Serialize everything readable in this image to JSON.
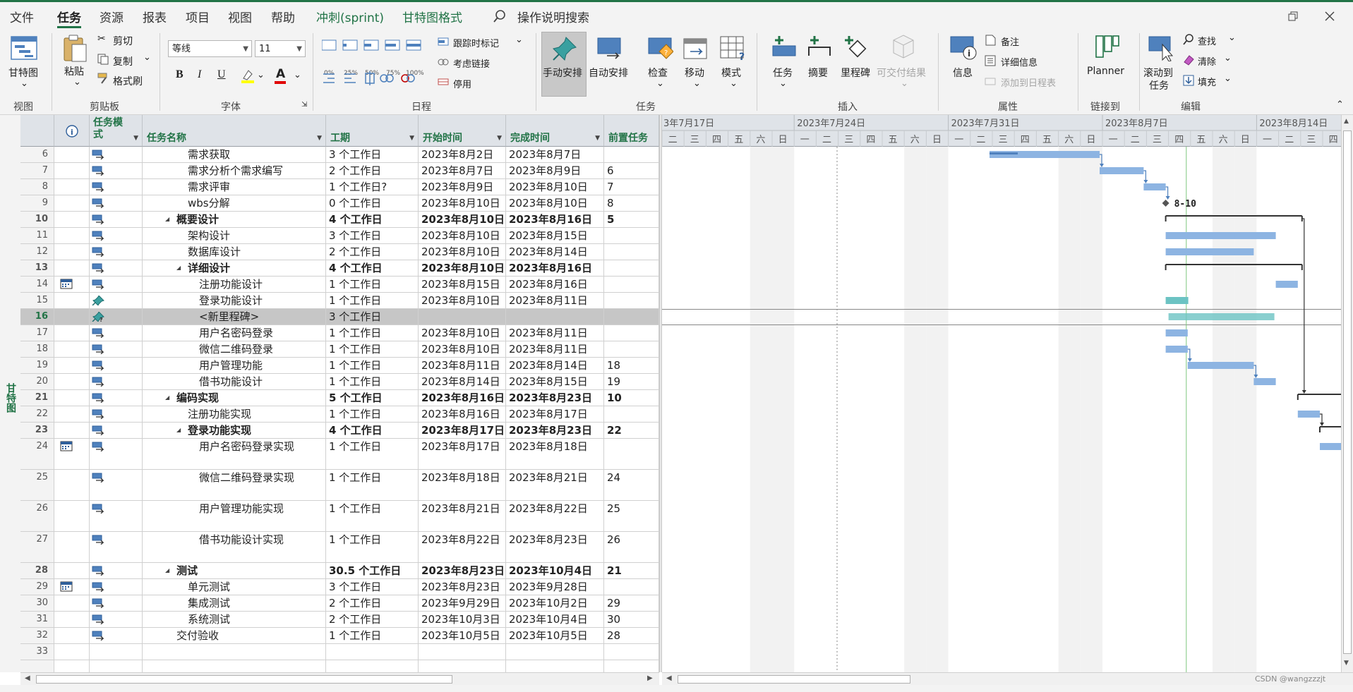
{
  "menu": {
    "items": [
      "文件",
      "任务",
      "资源",
      "报表",
      "项目",
      "视图",
      "帮助",
      "冲刺(sprint)",
      "甘特图格式"
    ],
    "search": "操作说明搜索"
  },
  "ribbon": {
    "gantt_view": "甘特图",
    "paste": "粘贴",
    "cut": "剪切",
    "copy": "复制",
    "format_painter": "格式刷",
    "font_name": "等线",
    "font_size": "11",
    "bold": "B",
    "italic": "I",
    "underline": "U",
    "pct": [
      "0%",
      "25%",
      "50%",
      "75%",
      "100%"
    ],
    "mark_on_track": "跟踪时标记",
    "respect_links": "考虑链接",
    "inactivate": "停用",
    "manual_schedule": "手动安排",
    "auto_schedule": "自动安排",
    "inspect": "检查",
    "move": "移动",
    "mode": "模式",
    "task": "任务",
    "summary": "摘要",
    "milestone": "里程碑",
    "deliverable": "可交付结果",
    "information": "信息",
    "notes": "备注",
    "details": "详细信息",
    "add_to_timeline": "添加到日程表",
    "planner": "Planner",
    "scroll_to_task_1": "滚动到",
    "scroll_to_task_2": "任务",
    "find": "查找",
    "clear": "清除",
    "fill": "填充",
    "groups": [
      "视图",
      "剪贴板",
      "字体",
      "日程",
      "任务",
      "插入",
      "属性",
      "链接到",
      "编辑"
    ]
  },
  "sidebar_label": "甘特图",
  "table": {
    "headers": [
      "任务模式",
      "任务名称",
      "工期",
      "开始时间",
      "完成时间",
      "前置任务"
    ],
    "rows": [
      {
        "id": "6",
        "name": "需求获取",
        "duration": "3 个工作日",
        "start": "2023年8月2日",
        "finish": "2023年8月7日",
        "pred": "",
        "indent": 2,
        "bold": false,
        "summary": false,
        "mode": "auto"
      },
      {
        "id": "7",
        "name": "需求分析个需求编写",
        "duration": "2 个工作日",
        "start": "2023年8月7日",
        "finish": "2023年8月9日",
        "pred": "6",
        "indent": 2,
        "bold": false,
        "summary": false,
        "mode": "auto"
      },
      {
        "id": "8",
        "name": "需求评审",
        "duration": "1 个工作日?",
        "start": "2023年8月9日",
        "finish": "2023年8月10日",
        "pred": "7",
        "indent": 2,
        "bold": false,
        "summary": false,
        "mode": "auto"
      },
      {
        "id": "9",
        "name": "wbs分解",
        "duration": "0 个工作日",
        "start": "2023年8月10日",
        "finish": "2023年8月10日",
        "pred": "8",
        "indent": 2,
        "bold": false,
        "summary": false,
        "mode": "auto"
      },
      {
        "id": "10",
        "name": "概要设计",
        "duration": "4 个工作日",
        "start": "2023年8月10日",
        "finish": "2023年8月16日",
        "pred": "5",
        "indent": 1,
        "bold": true,
        "summary": true,
        "mode": "auto"
      },
      {
        "id": "11",
        "name": "架构设计",
        "duration": "3 个工作日",
        "start": "2023年8月10日",
        "finish": "2023年8月15日",
        "pred": "",
        "indent": 2,
        "bold": false,
        "summary": false,
        "mode": "auto"
      },
      {
        "id": "12",
        "name": "数据库设计",
        "duration": "2 个工作日",
        "start": "2023年8月10日",
        "finish": "2023年8月14日",
        "pred": "",
        "indent": 2,
        "bold": false,
        "summary": false,
        "mode": "auto"
      },
      {
        "id": "13",
        "name": "详细设计",
        "duration": "4 个工作日",
        "start": "2023年8月10日",
        "finish": "2023年8月16日",
        "pred": "",
        "indent": 2,
        "bold": true,
        "summary": true,
        "mode": "auto"
      },
      {
        "id": "14",
        "name": "注册功能设计",
        "duration": "1 个工作日",
        "start": "2023年8月15日",
        "finish": "2023年8月16日",
        "pred": "",
        "indent": 3,
        "bold": false,
        "summary": false,
        "mode": "auto",
        "cal": true
      },
      {
        "id": "15",
        "name": "登录功能设计",
        "duration": "1 个工作日",
        "start": "2023年8月10日",
        "finish": "2023年8月11日",
        "pred": "",
        "indent": 3,
        "bold": false,
        "summary": false,
        "mode": "manual"
      },
      {
        "id": "16",
        "name": "<新里程碑>",
        "duration": "3 个工作日",
        "start": "",
        "finish": "",
        "pred": "",
        "indent": 3,
        "bold": false,
        "summary": false,
        "mode": "manual-new",
        "selected": true
      },
      {
        "id": "17",
        "name": "用户名密码登录",
        "duration": "1 个工作日",
        "start": "2023年8月10日",
        "finish": "2023年8月11日",
        "pred": "",
        "indent": 3,
        "bold": false,
        "summary": false,
        "mode": "auto"
      },
      {
        "id": "18",
        "name": "微信二维码登录",
        "duration": "1 个工作日",
        "start": "2023年8月10日",
        "finish": "2023年8月11日",
        "pred": "",
        "indent": 3,
        "bold": false,
        "summary": false,
        "mode": "auto"
      },
      {
        "id": "19",
        "name": "用户管理功能",
        "duration": "1 个工作日",
        "start": "2023年8月11日",
        "finish": "2023年8月14日",
        "pred": "18",
        "indent": 3,
        "bold": false,
        "summary": false,
        "mode": "auto"
      },
      {
        "id": "20",
        "name": "借书功能设计",
        "duration": "1 个工作日",
        "start": "2023年8月14日",
        "finish": "2023年8月15日",
        "pred": "19",
        "indent": 3,
        "bold": false,
        "summary": false,
        "mode": "auto"
      },
      {
        "id": "21",
        "name": "编码实现",
        "duration": "5 个工作日",
        "start": "2023年8月16日",
        "finish": "2023年8月23日",
        "pred": "10",
        "indent": 1,
        "bold": true,
        "summary": true,
        "mode": "auto"
      },
      {
        "id": "22",
        "name": "注册功能实现",
        "duration": "1 个工作日",
        "start": "2023年8月16日",
        "finish": "2023年8月17日",
        "pred": "",
        "indent": 2,
        "bold": false,
        "summary": false,
        "mode": "auto"
      },
      {
        "id": "23",
        "name": "登录功能实现",
        "duration": "4 个工作日",
        "start": "2023年8月17日",
        "finish": "2023年8月23日",
        "pred": "22",
        "indent": 2,
        "bold": true,
        "summary": true,
        "mode": "auto"
      },
      {
        "id": "24",
        "name": "用户名密码登录实现",
        "duration": "1 个工作日",
        "start": "2023年8月17日",
        "finish": "2023年8月18日",
        "pred": "",
        "indent": 3,
        "bold": false,
        "summary": false,
        "mode": "auto",
        "cal": true,
        "tall": true
      },
      {
        "id": "25",
        "name": "微信二维码登录实现",
        "duration": "1 个工作日",
        "start": "2023年8月18日",
        "finish": "2023年8月21日",
        "pred": "24",
        "indent": 3,
        "bold": false,
        "summary": false,
        "mode": "auto",
        "tall": true
      },
      {
        "id": "26",
        "name": "用户管理功能实现",
        "duration": "1 个工作日",
        "start": "2023年8月21日",
        "finish": "2023年8月22日",
        "pred": "25",
        "indent": 3,
        "bold": false,
        "summary": false,
        "mode": "auto",
        "tall": true
      },
      {
        "id": "27",
        "name": "借书功能设计实现",
        "duration": "1 个工作日",
        "start": "2023年8月22日",
        "finish": "2023年8月23日",
        "pred": "26",
        "indent": 3,
        "bold": false,
        "summary": false,
        "mode": "auto",
        "tall": true
      },
      {
        "id": "28",
        "name": "测试",
        "duration": "30.5 个工作日",
        "start": "2023年8月23日",
        "finish": "2023年10月4日",
        "pred": "21",
        "indent": 1,
        "bold": true,
        "summary": true,
        "mode": "auto"
      },
      {
        "id": "29",
        "name": "单元测试",
        "duration": "3 个工作日",
        "start": "2023年8月23日",
        "finish": "2023年9月28日",
        "pred": "",
        "indent": 2,
        "bold": false,
        "summary": false,
        "mode": "auto",
        "cal": true
      },
      {
        "id": "30",
        "name": "集成测试",
        "duration": "2 个工作日",
        "start": "2023年9月29日",
        "finish": "2023年10月2日",
        "pred": "29",
        "indent": 2,
        "bold": false,
        "summary": false,
        "mode": "auto"
      },
      {
        "id": "31",
        "name": "系统测试",
        "duration": "2 个工作日",
        "start": "2023年10月3日",
        "finish": "2023年10月4日",
        "pred": "30",
        "indent": 2,
        "bold": false,
        "summary": false,
        "mode": "auto"
      },
      {
        "id": "32",
        "name": "交付验收",
        "duration": "1 个工作日",
        "start": "2023年10月5日",
        "finish": "2023年10月5日",
        "pred": "28",
        "indent": 1,
        "bold": false,
        "summary": false,
        "mode": "auto"
      },
      {
        "id": "33",
        "name": "",
        "duration": "",
        "start": "",
        "finish": "",
        "pred": "",
        "indent": 0,
        "bold": false,
        "summary": false,
        "mode": "none"
      }
    ]
  },
  "timescale": {
    "weeks": [
      "3年7月17日",
      "2023年7月24日",
      "2023年7月31日",
      "2023年8月7日",
      "2023年8月14日"
    ],
    "days": [
      "一",
      "二",
      "三",
      "四",
      "五",
      "六",
      "日"
    ]
  },
  "milestone_label": "8-10",
  "watermark": "CSDN @wangzzzjt",
  "colors": {
    "accent": "#217346",
    "bar": "#8db4e2",
    "bar_dark": "#4f81bd",
    "manual_bar": "#6cc3c3"
  }
}
